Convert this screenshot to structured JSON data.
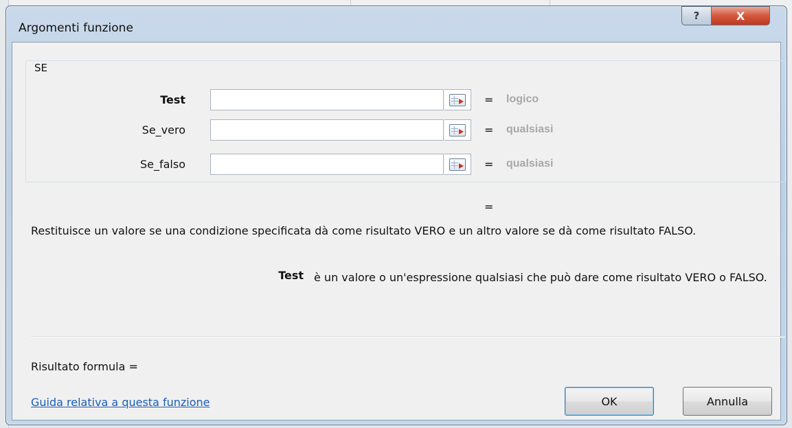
{
  "window": {
    "title": "Argomenti funzione",
    "help_glyph": "?",
    "close_glyph": "X"
  },
  "group": {
    "label": "SE"
  },
  "arguments": [
    {
      "label": "Test",
      "value": "",
      "eq": "=",
      "hint": "logico",
      "bold": true
    },
    {
      "label": "Se_vero",
      "value": "",
      "eq": "=",
      "hint": "qualsiasi",
      "bold": false
    },
    {
      "label": "Se_falso",
      "value": "",
      "eq": "=",
      "hint": "qualsiasi",
      "bold": false
    }
  ],
  "result_equals": "=",
  "description": "Restituisce un valore se una condizione specificata dà come risultato VERO e un altro valore se dà come risultato FALSO.",
  "arg_help": {
    "name": "Test",
    "text": "è un valore o un'espressione qualsiasi che può dare come risultato VERO o FALSO."
  },
  "formula_result": "Risultato formula =",
  "help_link": "Guida relativa a questa funzione",
  "buttons": {
    "ok": "OK",
    "cancel": "Annulla"
  },
  "icons": {
    "help": "help-icon",
    "close": "close-icon",
    "ref": "collapse-dialog-icon"
  },
  "colors": {
    "hint": "#a8a8a8",
    "link": "#1a5db8",
    "close_button": "#d4573d"
  }
}
